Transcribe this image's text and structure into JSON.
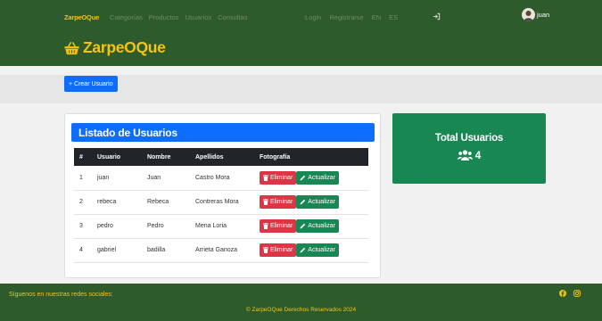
{
  "nav": {
    "brand": "ZarpeOQue",
    "links": [
      "Categorías",
      "Productos",
      "Usuarios",
      "Consultas"
    ],
    "auth": [
      "Login",
      "Registrarse",
      "EN",
      "ES"
    ],
    "user": "juan",
    "brand_large": "ZarpeOQue"
  },
  "toolbar": {
    "create_label": "+ Crear Usuario"
  },
  "users_card": {
    "title": "Listado de Usuarios",
    "columns": [
      "#",
      "Usuario",
      "Nombre",
      "Apellidos",
      "Fotografía"
    ],
    "rows": [
      {
        "id": "1",
        "usuario": "juan",
        "nombre": "Juan",
        "apellidos": "Castro Mora"
      },
      {
        "id": "2",
        "usuario": "rebeca",
        "nombre": "Rebeca",
        "apellidos": "Contreras Mora"
      },
      {
        "id": "3",
        "usuario": "pedro",
        "nombre": "Pedro",
        "apellidos": "Mena Loria"
      },
      {
        "id": "4",
        "usuario": "gabriel",
        "nombre": "badilla",
        "apellidos": "Arrieta Ganoza"
      }
    ],
    "delete_label": "Eliminar",
    "update_label": "Actualizar"
  },
  "total_card": {
    "title": "Total Usuarios",
    "count": "4"
  },
  "footer": {
    "follow": "Síguenos en nuestras redes sociales:",
    "copyright": "© ZarpeOQue Derechos Reservados 2024"
  },
  "colors": {
    "header_bg": "#2e5b2b",
    "brand_yellow": "#f6c30f",
    "primary": "#0d6efd",
    "success": "#198754",
    "danger": "#dc3545",
    "table_head": "#212529"
  },
  "icons": [
    "basket-icon",
    "login-icon",
    "avatar-icon",
    "trash-icon",
    "pencil-icon",
    "users-icon",
    "facebook-icon",
    "instagram-icon"
  ]
}
